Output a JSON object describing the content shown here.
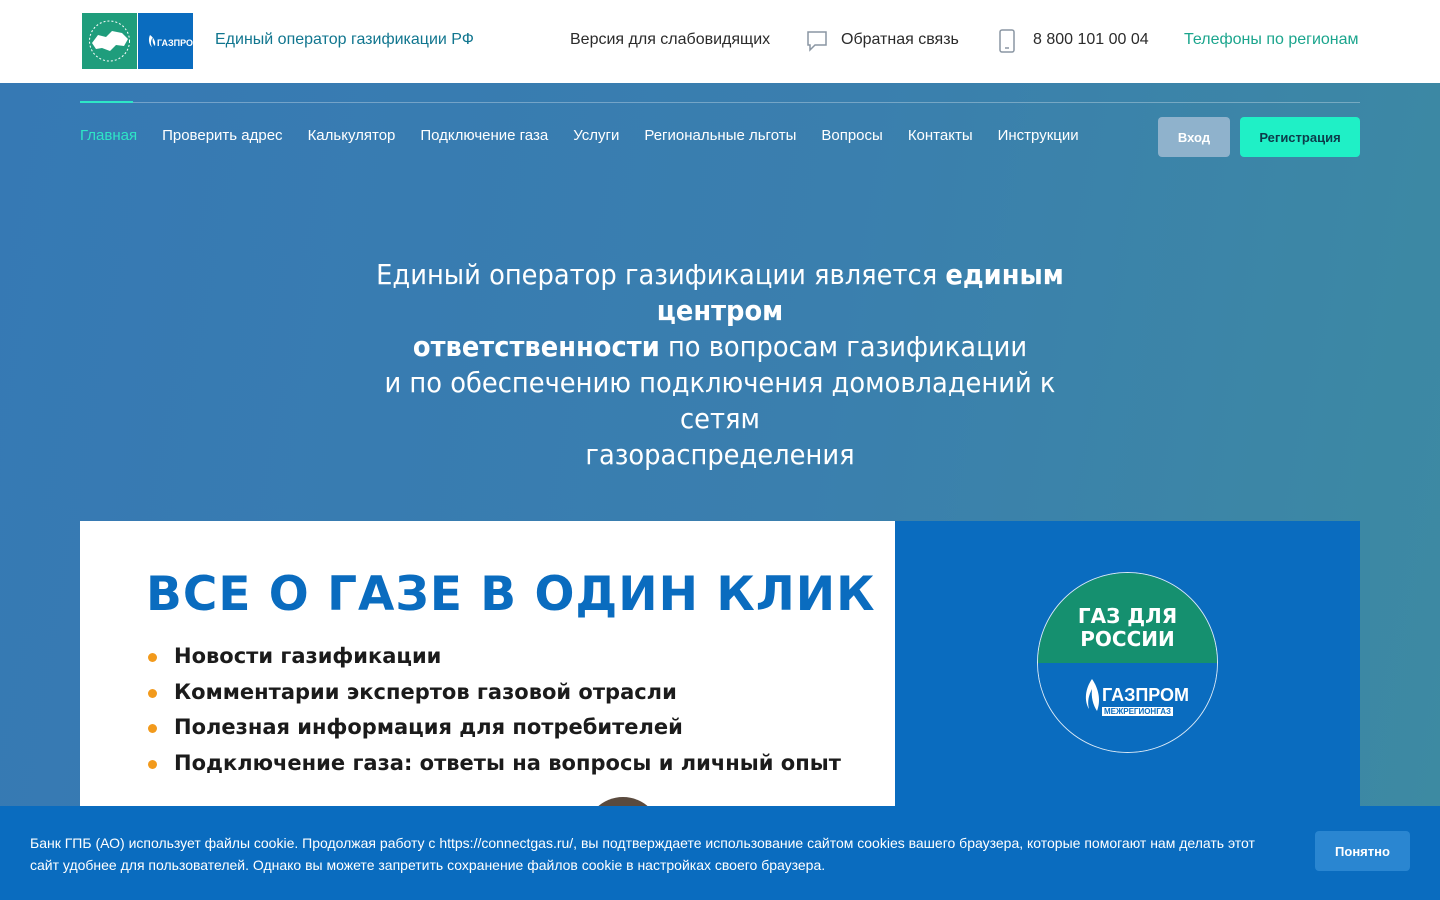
{
  "header": {
    "site_title": "Единый оператор газификации РФ",
    "accessibility_link": "Версия для слабовидящих",
    "feedback_link": "Обратная связь",
    "phone": "8 800 101 00 04",
    "regions_link": "Телефоны по регионам",
    "logo_brand": "ГАЗПРОМ",
    "icons": [
      "chat-icon",
      "phone-icon"
    ]
  },
  "nav": {
    "items": [
      {
        "label": "Главная",
        "active": true
      },
      {
        "label": "Проверить адрес"
      },
      {
        "label": "Калькулятор"
      },
      {
        "label": "Подключение газа"
      },
      {
        "label": "Услуги"
      },
      {
        "label": "Региональные льготы"
      },
      {
        "label": "Вопросы"
      },
      {
        "label": "Контакты"
      },
      {
        "label": "Инструкции"
      }
    ],
    "login_label": "Вход",
    "register_label": "Регистрация"
  },
  "hero": {
    "line1_pre": "Единый оператор газификации является ",
    "line1_bold": "единым центром",
    "line2_bold": "ответственности",
    "line2_post": " по вопросам газификации",
    "line3": "и по обеспечению подключения домовладений к сетям",
    "line4": "газораспределения"
  },
  "banner": {
    "title": "ВСЕ О ГАЗЕ В ОДИН КЛИК",
    "items": [
      "Новости газификации",
      "Комментарии экспертов газовой отрасли",
      "Полезная информация для потребителей",
      "Подключение газа: ответы на вопросы и личный опыт"
    ],
    "circle_line1": "ГАЗ ДЛЯ",
    "circle_line2": "РОССИИ",
    "circle_brand": "ГАЗПРОМ",
    "circle_sub": "МЕЖРЕГИОНГАЗ"
  },
  "cookie": {
    "text": "Банк ГПБ (АО) использует файлы cookie. Продолжая работу с https://connectgas.ru/, вы подтверждаете использование сайтом cookies вашего браузера, которые помогают нам делать этот сайт удобнее для пользователей. Однако вы можете запретить сохранение файлов cookie в настройках своего браузера.",
    "button": "Понятно"
  },
  "colors": {
    "accent": "#2ee6c6",
    "brand_blue": "#0a6cbf",
    "brand_green": "#1f9d7c",
    "bullet": "#f29a1c"
  }
}
